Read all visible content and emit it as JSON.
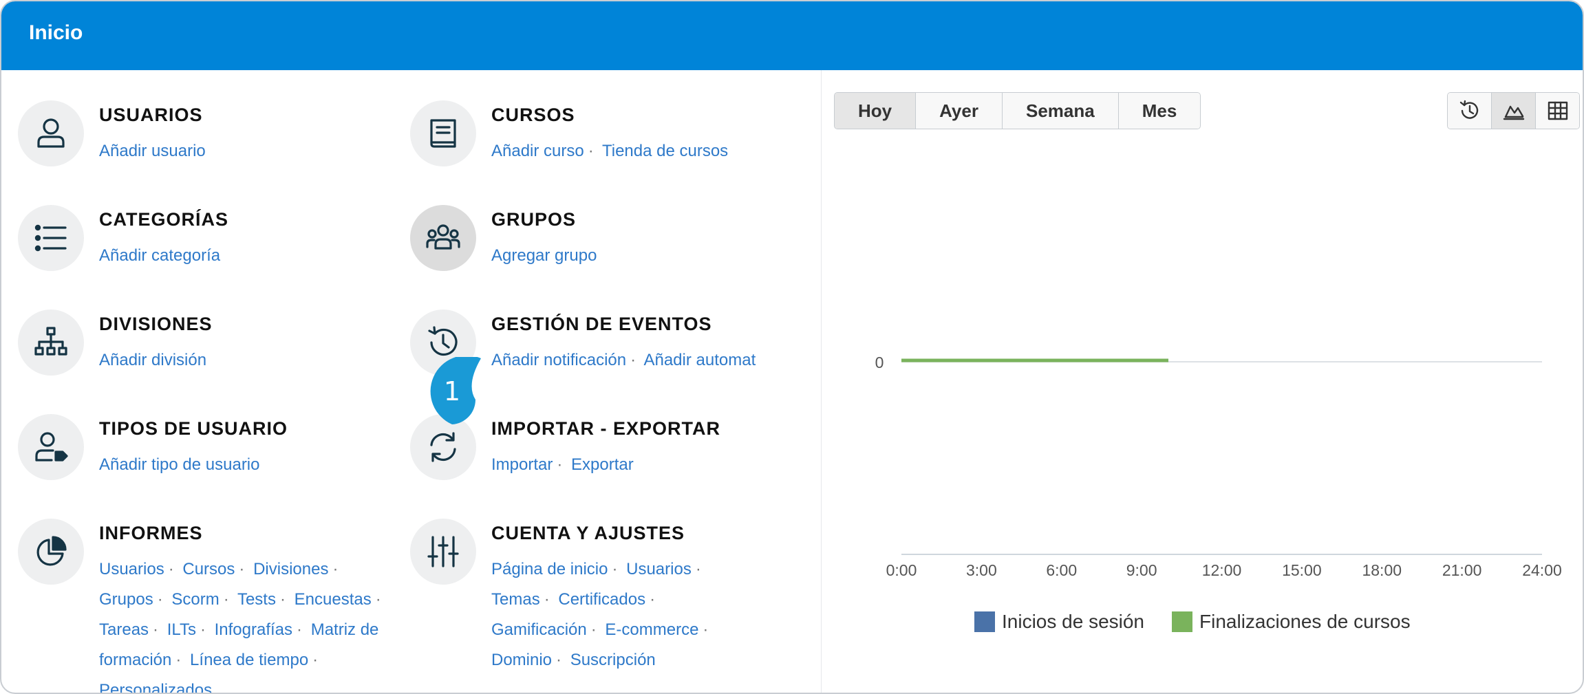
{
  "header": {
    "title": "Inicio"
  },
  "tiles": {
    "usuarios": {
      "title": "USUARIOS",
      "links": [
        "Añadir usuario"
      ]
    },
    "cursos": {
      "title": "CURSOS",
      "links": [
        "Añadir curso",
        "Tienda de cursos"
      ]
    },
    "categorias": {
      "title": "CATEGORÍAS",
      "links": [
        "Añadir categoría"
      ]
    },
    "grupos": {
      "title": "GRUPOS",
      "links": [
        "Agregar grupo"
      ]
    },
    "divisiones": {
      "title": "DIVISIONES",
      "links": [
        "Añadir división"
      ]
    },
    "eventos": {
      "title": "GESTIÓN DE EVENTOS",
      "links": [
        "Añadir notificación",
        "Añadir automat"
      ]
    },
    "tipos": {
      "title": "TIPOS DE USUARIO",
      "links": [
        "Añadir tipo de usuario"
      ]
    },
    "importar": {
      "title": "IMPORTAR - EXPORTAR",
      "links": [
        "Importar",
        "Exportar"
      ]
    },
    "informes": {
      "title": "INFORMES",
      "links": [
        "Usuarios",
        "Cursos",
        "Divisiones",
        "Grupos",
        "Scorm",
        "Tests",
        "Encuestas",
        "Tareas",
        "ILTs",
        "Infografías",
        "Matriz de formación",
        "Línea de tiempo",
        "Personalizados"
      ]
    },
    "cuenta": {
      "title": "CUENTA Y AJUSTES",
      "links": [
        "Página de inicio",
        "Usuarios",
        "Temas",
        "Certificados",
        "Gamificación",
        "E-commerce",
        "Dominio",
        "Suscripción"
      ]
    }
  },
  "callout": {
    "number": "1"
  },
  "period_tabs": [
    {
      "label": "Hoy",
      "active": true
    },
    {
      "label": "Ayer",
      "active": false
    },
    {
      "label": "Semana",
      "active": false
    },
    {
      "label": "Mes",
      "active": false
    }
  ],
  "view_buttons": [
    {
      "icon": "history-icon",
      "active": false
    },
    {
      "icon": "area-chart-icon",
      "active": true
    },
    {
      "icon": "table-grid-icon",
      "active": false
    }
  ],
  "colors": {
    "header": "#0084d8",
    "link": "#2e79c9",
    "series_logins": "#4a72a8",
    "series_completions": "#7ab35c"
  },
  "chart_data": {
    "type": "line",
    "x": [
      "0:00",
      "3:00",
      "6:00",
      "9:00",
      "12:00",
      "15:00",
      "18:00",
      "21:00",
      "24:00"
    ],
    "y_ticks": [
      "0"
    ],
    "series": [
      {
        "name": "Inicios de sesión",
        "color": "#4a72a8",
        "x_hours": [
          0,
          10
        ],
        "values": [
          0,
          0
        ]
      },
      {
        "name": "Finalizaciones de cursos",
        "color": "#7ab35c",
        "x_hours": [
          0,
          10
        ],
        "values": [
          0,
          0
        ]
      }
    ],
    "xlim": [
      0,
      24
    ],
    "ylim": [
      0,
      0
    ],
    "legend": "bottom"
  }
}
